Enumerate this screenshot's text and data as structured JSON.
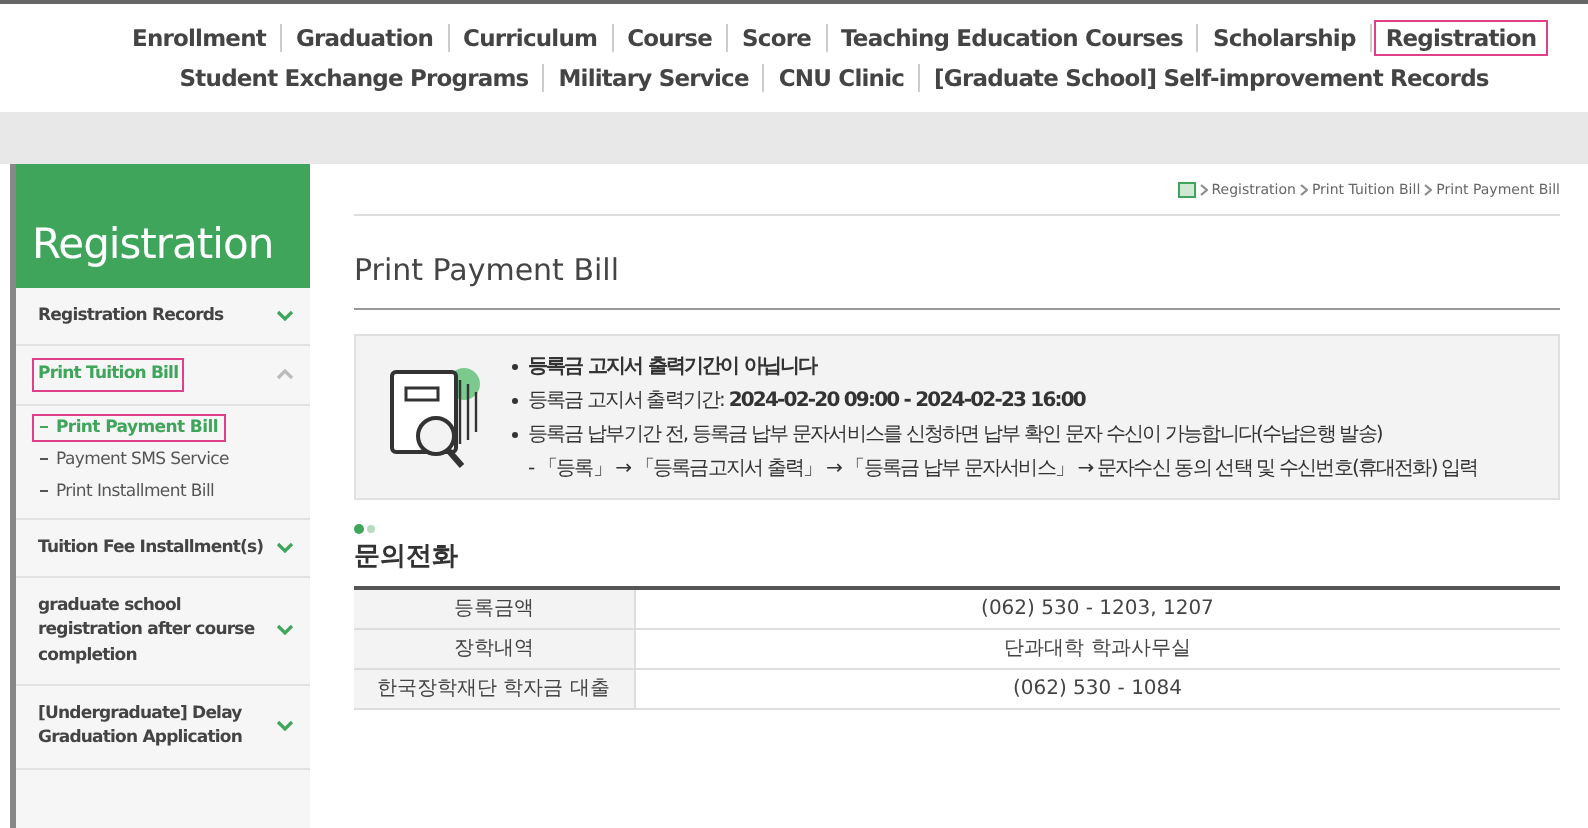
{
  "top_nav": {
    "primary": [
      {
        "label": "Enrollment",
        "selected": false
      },
      {
        "label": "Graduation",
        "selected": false
      },
      {
        "label": "Curriculum",
        "selected": false
      },
      {
        "label": "Course",
        "selected": false
      },
      {
        "label": "Score",
        "selected": false
      },
      {
        "label": "Teaching Education Courses",
        "selected": false
      },
      {
        "label": "Scholarship",
        "selected": false
      },
      {
        "label": "Registration",
        "selected": true
      }
    ],
    "secondary": [
      {
        "label": "Student Exchange Programs",
        "selected": false
      },
      {
        "label": "Military Service",
        "selected": false
      },
      {
        "label": "CNU Clinic",
        "selected": false
      },
      {
        "label": "[Graduate School] Self-improvement Records",
        "selected": false
      }
    ]
  },
  "sidebar": {
    "title": "Registration",
    "items": [
      {
        "label": "Registration Records",
        "selected": false,
        "expanded": false
      },
      {
        "label": "Print Tuition Bill",
        "selected": true,
        "expanded": true,
        "children": [
          {
            "label": "Print Payment Bill",
            "selected": true
          },
          {
            "label": "Payment SMS Service",
            "selected": false
          },
          {
            "label": "Print Installment Bill",
            "selected": false
          }
        ]
      },
      {
        "label": "Tuition Fee Installment(s)",
        "selected": false,
        "expanded": false
      },
      {
        "label": "graduate school registration after course completion",
        "selected": false,
        "expanded": false
      },
      {
        "label": "[Undergraduate] Delay Graduation Application",
        "selected": false,
        "expanded": false
      }
    ]
  },
  "breadcrumb": [
    "Registration",
    "Print Tuition Bill",
    "Print Payment Bill"
  ],
  "page_title": "Print Payment Bill",
  "notice": {
    "lines": [
      {
        "kind": "bullet",
        "text": "**등록금 고지서 출력기간이 아닙니다**"
      },
      {
        "kind": "bullet",
        "text": "등록금 고지서 출력기간: **2024-02-20 09:00 - 2024-02-23 16:00**"
      },
      {
        "kind": "bullet",
        "text": "등록금 납부기간 전, 등록금 납부 문자서비스를 신청하면 납부 확인 문자 수신이 가능합니다(수납은행 발송)"
      },
      {
        "kind": "sub",
        "text": "- 「등록」 → 「등록금고지서 출력」 → 「등록금 납부 문자서비스」 → 문자수신 동의 선택 및 수신번호(휴대전화) 입력"
      }
    ]
  },
  "contact": {
    "title": "문의전화",
    "rows": [
      {
        "label": "등록금액",
        "value": "(062) 530 - 1203, 1207"
      },
      {
        "label": "장학내역",
        "value": "단과대학 학과사무실"
      },
      {
        "label": "한국장학재단 학자금 대출",
        "value": "(062) 530 - 1084"
      }
    ]
  }
}
